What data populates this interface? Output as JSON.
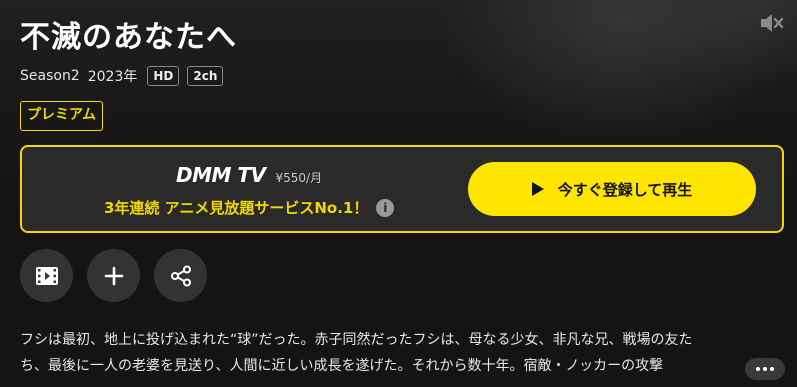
{
  "title": "不滅のあなたへ",
  "meta": {
    "season": "Season2",
    "year": "2023年",
    "quality": "HD",
    "audio": "2ch"
  },
  "premium_label": "プレミアム",
  "promo": {
    "logo": "DMM TV",
    "price": "¥550/月",
    "tagline": "3年連続 アニメ見放題サービスNo.1！",
    "info_glyph": "i",
    "cta_label": "今すぐ登録して再生",
    "accent": "#f5d800"
  },
  "actions": [
    {
      "icon": "video-icon"
    },
    {
      "icon": "plus-icon"
    },
    {
      "icon": "share-icon"
    }
  ],
  "mute_icon": "volume-mute-icon",
  "synopsis": {
    "line1": "フシは最初、地上に投げ込まれた“球”だった。赤子同然だったフシは、母なる少女、非凡な兄、戦場の友た",
    "line2": "ち、最後に一人の老婆を見送り、人間に近しい成長を遂げた。それから数十年。宿敵・ノッカーの攻撃"
  }
}
